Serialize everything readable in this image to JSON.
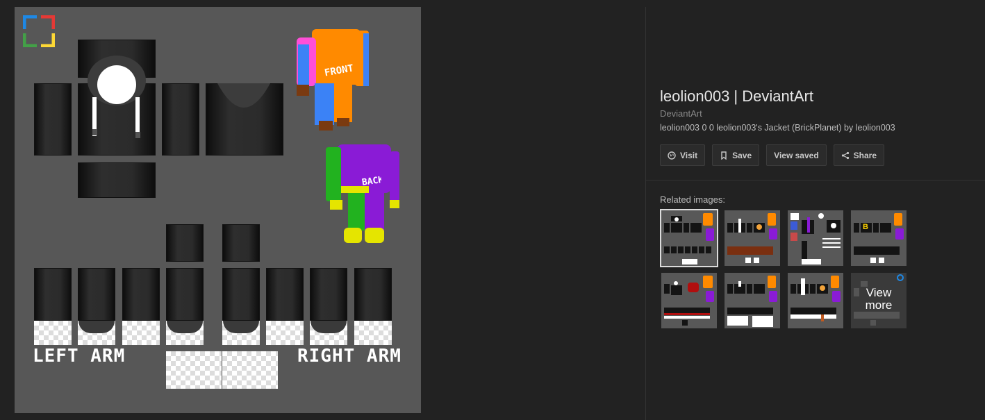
{
  "main_image": {
    "left_arm_label": "LEFT ARM",
    "right_arm_label": "RIGHT ARM",
    "front_label": "FRONT",
    "back_label": "BACK"
  },
  "info": {
    "title": "leolion003 | DeviantArt",
    "source": "DeviantArt",
    "description": "leolion003 0 0 leolion003's Jacket (BrickPlanet) by leolion003"
  },
  "actions": {
    "visit_label": "Visit",
    "save_label": "Save",
    "view_saved_label": "View saved",
    "share_label": "Share"
  },
  "related": {
    "label": "Related images:",
    "view_more_label": "View more",
    "thumbnails": [
      {
        "variant": "jacket-black",
        "selected": true
      },
      {
        "variant": "white-shirt"
      },
      {
        "variant": "guide-text"
      },
      {
        "variant": "rainbow-b"
      },
      {
        "variant": "red-logo"
      },
      {
        "variant": "white-pants"
      },
      {
        "variant": "tie-shirt"
      }
    ]
  },
  "colors": {
    "background": "#222222",
    "template_bg": "#575757",
    "logo_blue": "#1e88e5",
    "logo_red": "#e53935",
    "logo_green": "#43a047",
    "logo_yellow": "#fdd835"
  }
}
